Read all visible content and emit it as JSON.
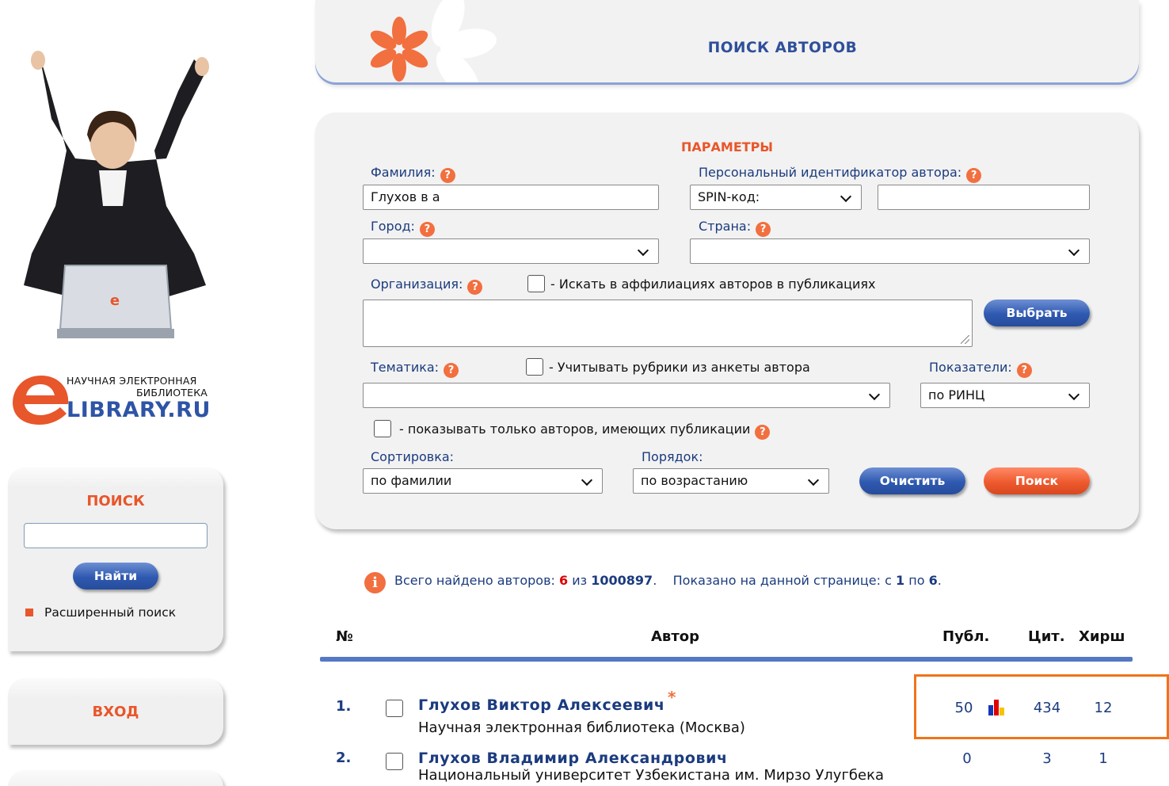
{
  "sidebar": {
    "logo": {
      "line1": "НАУЧНАЯ ЭЛЕКТРОННАЯ",
      "line2": "БИБЛИОТЕКА",
      "main": "LIBRARY.RU"
    },
    "search_panel": {
      "title": "ПОИСК",
      "find_button": "Найти",
      "advanced_link": "Расширенный поиск"
    },
    "login_panel": {
      "title": "ВХОД"
    }
  },
  "header": {
    "title": "ПОИСК АВТОРОВ"
  },
  "params": {
    "title": "ПАРАМЕТРЫ",
    "help_glyph": "?",
    "surname_label": "Фамилия:",
    "surname_value": "Глухов в а",
    "personal_id_label": "Персональный идентификатор автора:",
    "id_type_value": "SPIN-код:",
    "id_value": "",
    "city_label": "Город:",
    "city_value": "",
    "country_label": "Страна:",
    "country_value": "",
    "org_label": "Организация:",
    "org_affil_checkbox_label": "- Искать в аффилиациях авторов в публикациях",
    "org_value": "",
    "choose_button": "Выбрать",
    "topic_label": "Тематика:",
    "topic_checkbox_label": "- Учитывать рубрики из анкеты автора",
    "topic_value": "",
    "indicators_label": "Показатели:",
    "indicators_value": "по РИНЦ",
    "only_with_pubs_label": "- показывать только авторов, имеющих публикации",
    "sort_label": "Сортировка:",
    "sort_value": "по фамилии",
    "order_label": "Порядок:",
    "order_value": "по возрастанию",
    "clear_button": "Очистить",
    "search_button": "Поиск"
  },
  "results": {
    "info_glyph": "i",
    "summary_prefix": "Всего найдено авторов:",
    "found_count": "6",
    "of_word": "из",
    "total_count": "1000897",
    "shown_prefix": "Показано на данной странице: с",
    "shown_from": "1",
    "to_word": "по",
    "shown_to": "6",
    "columns": {
      "num": "№",
      "author": "Автор",
      "pubs": "Публ.",
      "cites": "Цит.",
      "hirsch": "Хирш"
    },
    "rows": [
      {
        "num": "1.",
        "name": "Глухов Виктор Алексеевич",
        "org": "Научная электронная библиотека (Москва)",
        "pubs": "50",
        "cites": "434",
        "hirsch": "12",
        "has_star": true,
        "has_chart_icon": true
      },
      {
        "num": "2.",
        "name": "Глухов Владимир Александрович",
        "org": "Национальный университет Узбекистана им. Мирзо Улугбека",
        "pubs": "0",
        "cites": "3",
        "hirsch": "1",
        "has_star": false,
        "has_chart_icon": false
      }
    ]
  },
  "colors": {
    "accent_orange": "#e8562b",
    "brand_blue": "#2f59b0",
    "text_blue": "#1b3b7f",
    "highlight_box": "#f07318"
  }
}
